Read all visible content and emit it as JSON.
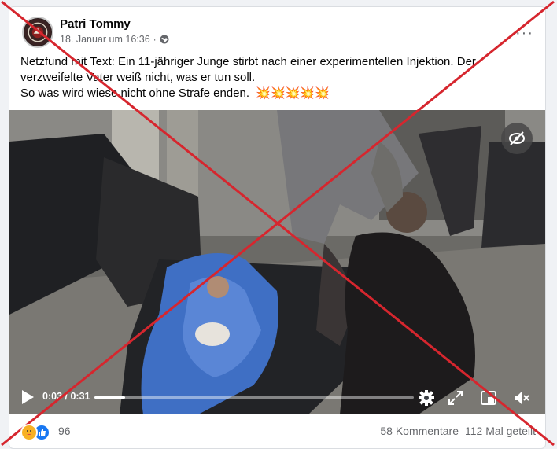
{
  "post": {
    "author": "Patri Tommy",
    "date": "18. Januar um 16:36",
    "meta_separator": "·",
    "audience_icon": "globe-icon",
    "more_options_label": "···",
    "text_lines": [
      "Netzfund mit Text: Ein 11-jähriger Junge stirbt nach einer experimentellen Injektion. Der",
      "verzweifelte Vater weiß nicht, was er tun soll.",
      "So was wird wieso nicht ohne Strafe enden."
    ],
    "emojis": "💥💥💥💥💥"
  },
  "video": {
    "time_current": "0:03",
    "time_separator": " / ",
    "time_total": "0:31",
    "progress_fraction": 0.097,
    "controls": [
      "play-icon",
      "settings-icon",
      "fullscreen-icon",
      "picture-in-picture-icon",
      "volume-muted-icon"
    ],
    "hide_icon": "eye-slash-icon"
  },
  "footer": {
    "reaction_count": "96",
    "comments": "58 Kommentare",
    "shares": "112 Mal geteilt"
  },
  "overlay": {
    "stroke_color": "#d6262e"
  }
}
